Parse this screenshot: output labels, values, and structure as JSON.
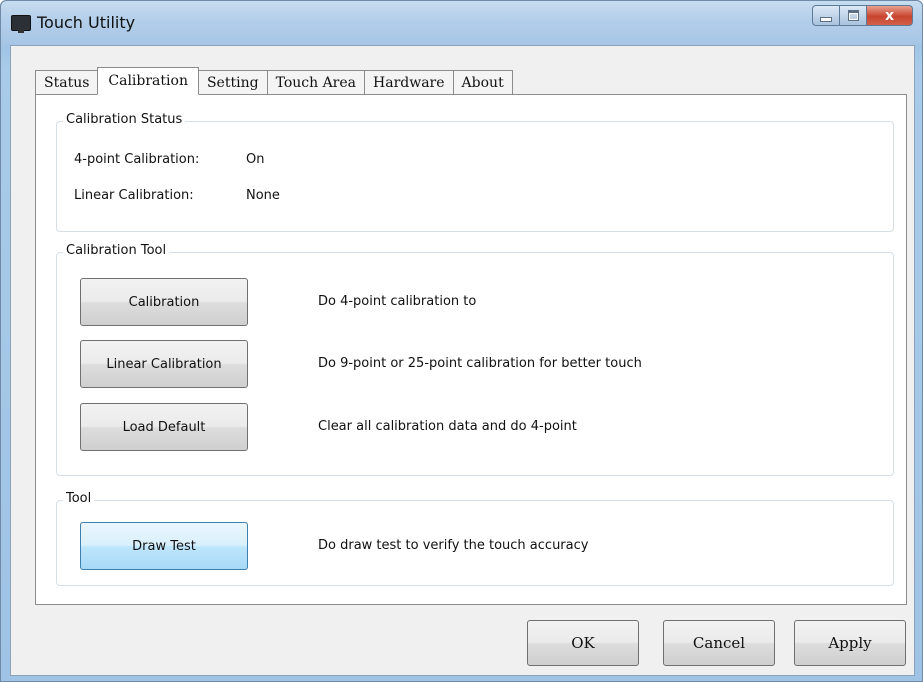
{
  "window": {
    "title": "Touch Utility",
    "icon": "monitor-icon",
    "controls": {
      "minimize": "minimize-icon",
      "maximize": "maximize-icon",
      "close_glyph": "x"
    }
  },
  "tabs": [
    {
      "label": "Status",
      "active": false
    },
    {
      "label": "Calibration",
      "active": true
    },
    {
      "label": "Setting",
      "active": false
    },
    {
      "label": "Touch Area",
      "active": false
    },
    {
      "label": "Hardware",
      "active": false
    },
    {
      "label": "About",
      "active": false
    }
  ],
  "calibration_status": {
    "legend": "Calibration Status",
    "rows": [
      {
        "label": "4-point Calibration:",
        "value": "On"
      },
      {
        "label": "Linear Calibration:",
        "value": "None"
      }
    ]
  },
  "calibration_tool": {
    "legend": "Calibration Tool",
    "items": [
      {
        "button": "Calibration",
        "description": "Do 4-point calibration to"
      },
      {
        "button": "Linear Calibration",
        "description": "Do 9-point or 25-point calibration for better touch"
      },
      {
        "button": "Load Default",
        "description": "Clear all calibration data and do 4-point"
      }
    ]
  },
  "tool": {
    "legend": "Tool",
    "button": "Draw Test",
    "description": "Do draw test to verify the touch accuracy"
  },
  "dialog_buttons": {
    "ok": "OK",
    "cancel": "Cancel",
    "apply": "Apply"
  },
  "colors": {
    "title_bar": "#b3cee9",
    "close_button": "#c8452f",
    "focused_button": "#bee6fd"
  }
}
